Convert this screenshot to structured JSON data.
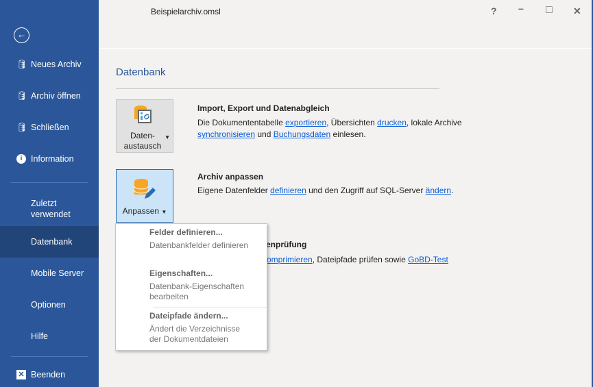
{
  "window": {
    "title": "Beispielarchiv.omsl",
    "help": "?",
    "minimize": "–",
    "maximize": "□",
    "close": "✕"
  },
  "sidebar": {
    "back_icon": "arrow-left-circle-icon",
    "items": [
      {
        "label": "Neues Archiv",
        "icon": "database-plus-icon"
      },
      {
        "label": "Archiv öffnen",
        "icon": "database-cursor-icon"
      },
      {
        "label": "Schließen",
        "icon": "database-x-icon"
      },
      {
        "label": "Information",
        "icon": "info-icon"
      },
      {
        "label": "Zuletzt verwendet"
      },
      {
        "label": "Datenbank",
        "selected": true
      },
      {
        "label": "Mobile Server"
      },
      {
        "label": "Optionen"
      },
      {
        "label": "Hilfe"
      },
      {
        "label": "Beenden",
        "icon": "close-box-icon"
      }
    ]
  },
  "main": {
    "title": "Datenbank",
    "sections": [
      {
        "button": "Daten-\naustausch",
        "button_l1": "Daten-",
        "button_l2": "austausch",
        "title": "Import, Export und Datenabgleich",
        "t1": "Die Dokumententabelle ",
        "l1": "exportieren",
        "t2": ", Übersichten ",
        "l2": "drucken",
        "t3": ", lokale Archive",
        "l3": "synchronisieren",
        "t4": " und ",
        "l4": "Buchungsdaten",
        "t5": " einlesen."
      },
      {
        "button": "Anpassen",
        "title": "Archiv anpassen",
        "t1": "Eigene Datenfelder ",
        "l1": "definieren",
        "t2": " und den Zugriff auf SQL-Server ",
        "l2": "ändern",
        "t3": "."
      },
      {
        "title_fragment": "enprüfung",
        "l1_fragment": "omprimieren",
        "t2": ", Dateipfade prüfen sowie ",
        "l2": "GoBD-Test"
      }
    ]
  },
  "menu": {
    "items": [
      {
        "title": "Felder definieren...",
        "desc": "Datenbankfelder definieren"
      },
      {
        "title": "Eigenschaften...",
        "desc1": "Datenbank-Eigenschaften",
        "desc2": "bearbeiten"
      },
      {
        "title": "Dateipfade ändern...",
        "desc1": "Ändert die Verzeichnisse",
        "desc2": "der Dokumentdateien"
      }
    ]
  },
  "colors": {
    "sidebar": "#2b579a",
    "selected": "#214579",
    "link": "#0b5ed7",
    "db_icon": "#f5a623"
  }
}
